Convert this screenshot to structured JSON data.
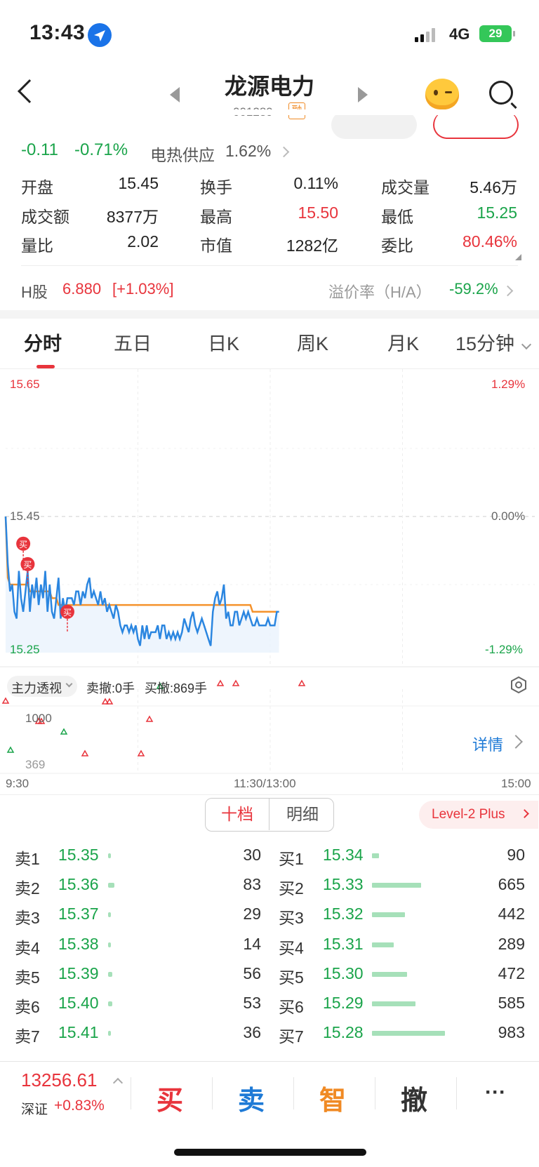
{
  "status_bar": {
    "time": "13:43",
    "network": "4G",
    "battery": "29"
  },
  "header": {
    "title": "龙源电力",
    "code": "001289",
    "badge": "融"
  },
  "quote": {
    "change": "-0.11",
    "change_pct": "-0.71%",
    "sector_name": "电热供应",
    "sector_pct": "1.62%",
    "stats": [
      {
        "label": "开盘",
        "value": "15.45",
        "color": "dark"
      },
      {
        "label": "换手",
        "value": "0.11%",
        "color": "dark"
      },
      {
        "label": "成交量",
        "value": "5.46万",
        "color": "dark"
      },
      {
        "label": "成交额",
        "value": "8377万",
        "color": "dark"
      },
      {
        "label": "最高",
        "value": "15.50",
        "color": "red"
      },
      {
        "label": "最低",
        "value": "15.25",
        "color": "green"
      },
      {
        "label": "量比",
        "value": "2.02",
        "color": "dark"
      },
      {
        "label": "市值",
        "value": "1282亿",
        "color": "dark"
      },
      {
        "label": "委比",
        "value": "80.46%",
        "color": "red"
      }
    ]
  },
  "h_share": {
    "label": "H股",
    "price": "6.880",
    "change": "[+1.03%]",
    "premium_label": "溢价率（H/A）",
    "premium_value": "-59.2%"
  },
  "tabs": [
    "分时",
    "五日",
    "日K",
    "周K",
    "月K",
    "15分钟"
  ],
  "chart": {
    "y_top": "15.65",
    "y_mid": "15.45",
    "y_bot": "15.25",
    "pct_top": "1.29%",
    "pct_mid": "0.00%",
    "pct_bot": "-1.29%",
    "marker_label": "买",
    "toolbar": {
      "mode": "主力透视",
      "sell_cancel": "卖撤:0手",
      "buy_cancel": "买撤:869手",
      "detail": "详情"
    },
    "vol_hi": "1000",
    "vol_lo": "369",
    "x_start": "9:30",
    "x_mid": "11:30/13:00",
    "x_end": "15:00"
  },
  "chart_data": {
    "type": "line",
    "ylim": [
      15.25,
      15.65
    ],
    "x": [
      "9:30",
      "11:30/13:00",
      "15:00"
    ],
    "series": [
      {
        "values": [
          15.45,
          15.38,
          15.34,
          15.35,
          15.31,
          15.3,
          15.37,
          15.33,
          15.31,
          15.34,
          15.37,
          15.31,
          15.35,
          15.33,
          15.36,
          15.32,
          15.35,
          15.33,
          15.37,
          15.31,
          15.35,
          15.31,
          15.3,
          15.33,
          15.36,
          15.3,
          15.33,
          15.31,
          15.33,
          15.33,
          15.33,
          15.32,
          15.34,
          15.34,
          15.32,
          15.34,
          15.33,
          15.35,
          15.36,
          15.33,
          15.34,
          15.33,
          15.32,
          15.34,
          15.32,
          15.33,
          15.31,
          15.32,
          15.31,
          15.3,
          15.32,
          15.31,
          15.29,
          15.28,
          15.29,
          15.29,
          15.28,
          15.29,
          15.28,
          15.29,
          15.27,
          15.26,
          15.29,
          15.27,
          15.29,
          15.27,
          15.28,
          15.28,
          15.28,
          15.29,
          15.27,
          15.29,
          15.29,
          15.27,
          15.28,
          15.27,
          15.28,
          15.27,
          15.28,
          15.27,
          15.28,
          15.3,
          15.29,
          15.28,
          15.3,
          15.31,
          15.29,
          15.28,
          15.29,
          15.3,
          15.29,
          15.28,
          15.27,
          15.26,
          15.31,
          15.33,
          15.34,
          15.32,
          15.33,
          15.35,
          15.3,
          15.31,
          15.29,
          15.29,
          15.31,
          15.31,
          15.29,
          15.3,
          15.31,
          15.3,
          15.31,
          15.3,
          15.29,
          15.29,
          15.3,
          15.29,
          15.29,
          15.29,
          15.29,
          15.3,
          15.29,
          15.29,
          15.29,
          15.31,
          15.31
        ]
      },
      {
        "values": [
          15.45,
          15.36,
          15.35,
          15.35,
          15.35,
          15.35,
          15.35,
          15.35,
          15.35,
          15.35,
          15.35,
          15.34,
          15.34,
          15.34,
          15.34,
          15.34,
          15.34,
          15.34,
          15.34,
          15.34,
          15.34,
          15.33,
          15.33,
          15.33,
          15.32,
          15.32,
          15.32,
          15.32,
          15.32,
          15.32,
          15.32,
          15.32,
          15.32,
          15.32,
          15.32,
          15.32,
          15.32,
          15.32,
          15.32,
          15.32,
          15.32,
          15.32,
          15.32,
          15.32,
          15.32,
          15.32,
          15.32,
          15.32,
          15.32,
          15.32,
          15.32,
          15.32,
          15.32,
          15.32,
          15.32,
          15.32,
          15.32,
          15.32,
          15.32,
          15.32,
          15.32,
          15.32,
          15.32,
          15.32,
          15.32,
          15.32,
          15.32,
          15.32,
          15.32,
          15.32,
          15.32,
          15.32,
          15.32,
          15.32,
          15.32,
          15.32,
          15.32,
          15.32,
          15.32,
          15.32,
          15.32,
          15.32,
          15.32,
          15.32,
          15.32,
          15.32,
          15.32,
          15.32,
          15.32,
          15.32,
          15.32,
          15.32,
          15.32,
          15.32,
          15.32,
          15.32,
          15.32,
          15.32,
          15.32,
          15.32,
          15.32,
          15.32,
          15.32,
          15.32,
          15.32,
          15.32,
          15.32,
          15.32,
          15.32,
          15.32,
          15.32,
          15.32,
          15.31,
          15.31,
          15.31,
          15.31,
          15.31,
          15.31,
          15.31,
          15.31,
          15.31,
          15.31,
          15.31,
          15.31,
          15.31
        ]
      }
    ]
  },
  "book_tabs": {
    "active": "十档",
    "other": "明细",
    "level2": "Level-2 Plus"
  },
  "order_book": {
    "sell": [
      {
        "label": "卖1",
        "price": "15.35",
        "vol": "30"
      },
      {
        "label": "卖2",
        "price": "15.36",
        "vol": "83"
      },
      {
        "label": "卖3",
        "price": "15.37",
        "vol": "29"
      },
      {
        "label": "卖4",
        "price": "15.38",
        "vol": "14"
      },
      {
        "label": "卖5",
        "price": "15.39",
        "vol": "56"
      },
      {
        "label": "卖6",
        "price": "15.40",
        "vol": "53"
      },
      {
        "label": "卖7",
        "price": "15.41",
        "vol": "36"
      }
    ],
    "buy": [
      {
        "label": "买1",
        "price": "15.34",
        "vol": "90"
      },
      {
        "label": "买2",
        "price": "15.33",
        "vol": "665"
      },
      {
        "label": "买3",
        "price": "15.32",
        "vol": "442"
      },
      {
        "label": "买4",
        "price": "15.31",
        "vol": "289"
      },
      {
        "label": "买5",
        "price": "15.30",
        "vol": "472"
      },
      {
        "label": "买6",
        "price": "15.29",
        "vol": "585"
      },
      {
        "label": "买7",
        "price": "15.28",
        "vol": "983"
      }
    ]
  },
  "bottom": {
    "index_value": "13256.61",
    "index_name": "深证",
    "index_change": "+0.83%",
    "buy": "买",
    "sell": "卖",
    "smart": "智",
    "cancel": "撤",
    "more": "···"
  },
  "colors": {
    "red": "#e8343c",
    "green": "#1aa44a",
    "blue": "#1e7ad6",
    "orange": "#f08a24"
  }
}
